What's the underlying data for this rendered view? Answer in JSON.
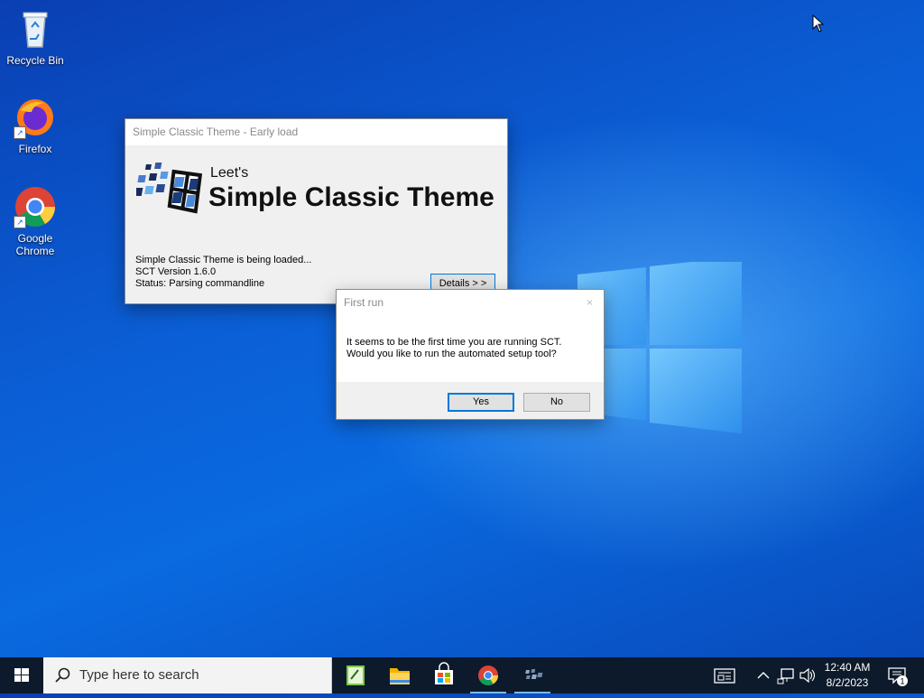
{
  "desktop": {
    "icons": [
      {
        "label": "Recycle Bin"
      },
      {
        "label": "Firefox"
      },
      {
        "label": "Google Chrome"
      }
    ]
  },
  "sct_window": {
    "title": "Simple Classic Theme - Early load",
    "banner_small": "Leet's",
    "banner_large": "Simple Classic Theme",
    "line1": "Simple Classic Theme is being loaded...",
    "line2": "SCT Version 1.6.0",
    "line3": "Status: Parsing commandline",
    "details_label": "Details > >"
  },
  "first_run_dialog": {
    "title": "First run",
    "close_glyph": "×",
    "message_line1": "It seems to be the first time you are running SCT.",
    "message_line2": "Would you like to run the automated setup tool?",
    "yes_label": "Yes",
    "no_label": "No"
  },
  "taskbar": {
    "search_placeholder": "Type here to search",
    "apps": [
      "Sticky Notes",
      "File Explorer",
      "Microsoft Store",
      "Google Chrome",
      "Simple Classic Theme"
    ],
    "time": "12:40 AM",
    "date": "8/2/2023",
    "notification_count": "1"
  },
  "colors": {
    "accent": "#0078d7",
    "taskbar_bg": "#0c1a2b",
    "desktop_blue": "#0b5fd6"
  }
}
